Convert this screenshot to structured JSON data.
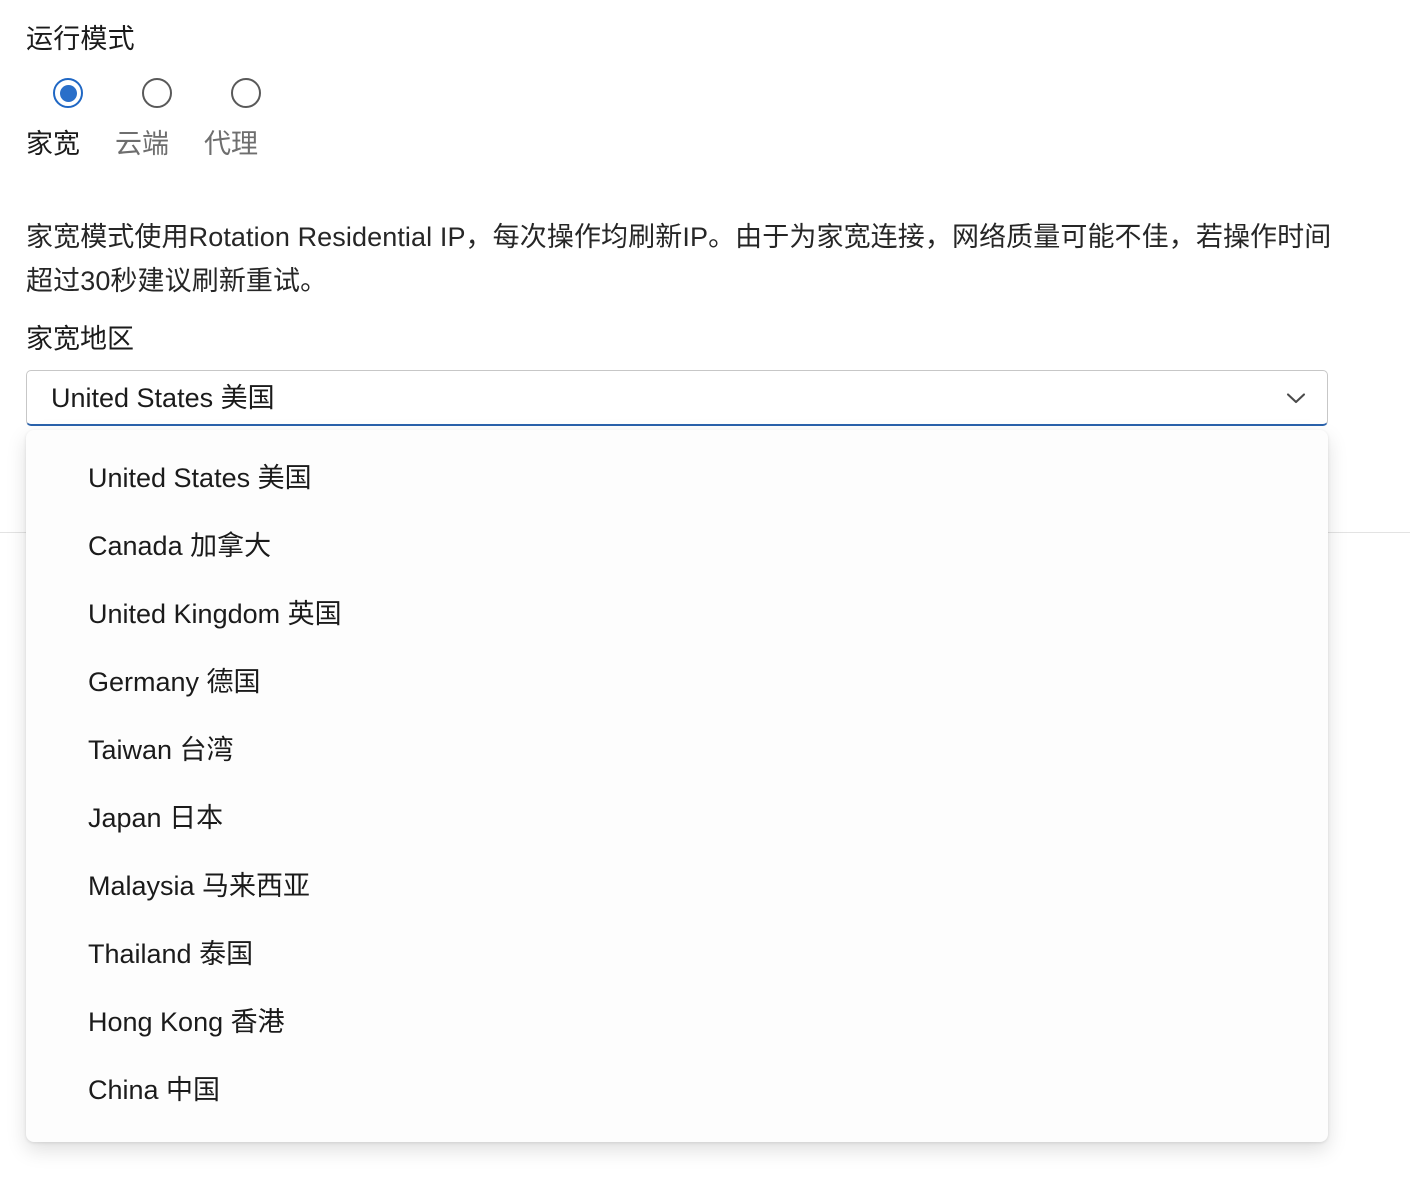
{
  "mode_section": {
    "label": "运行模式",
    "options": [
      {
        "label": "家宽",
        "selected": true
      },
      {
        "label": "云端",
        "selected": false
      },
      {
        "label": "代理",
        "selected": false
      }
    ],
    "description": "家宽模式使用Rotation Residential IP，每次操作均刷新IP。由于为家宽连接，网络质量可能不佳，若操作时间超过30秒建议刷新重试。"
  },
  "region_field": {
    "label": "家宽地区",
    "selected_value": "United States 美国",
    "chevron_icon": "chevron-down-icon",
    "options": [
      "United States 美国",
      "Canada 加拿大",
      "United Kingdom 英国",
      "Germany 德国",
      "Taiwan 台湾",
      "Japan 日本",
      "Malaysia 马来西亚",
      "Thailand 泰国",
      "Hong Kong 香港",
      "China 中国"
    ]
  },
  "colors": {
    "accent": "#2a6fc9",
    "focus_underline": "#2a62ac",
    "text_primary": "#1b1b1b",
    "text_muted": "#6e6e6e",
    "border": "#c7c7c7",
    "divider": "#e3e3e3"
  }
}
